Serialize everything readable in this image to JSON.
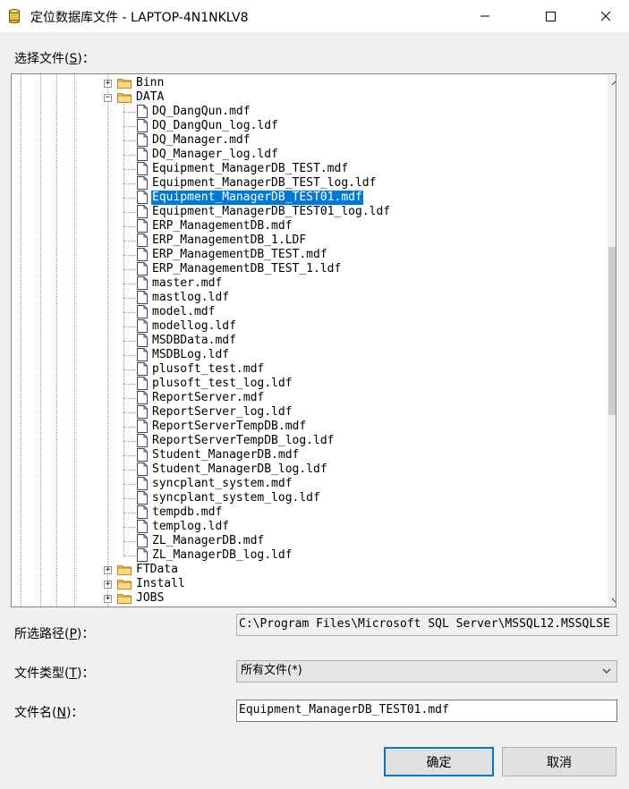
{
  "window": {
    "title": "定位数据库文件 - LAPTOP-4N1NKLV8",
    "icons": {
      "app": "database-icon",
      "minimize": "minimize-icon",
      "maximize": "maximize-icon",
      "close": "close-icon"
    }
  },
  "select_file_label": "选择文件(S)：",
  "tree": {
    "folders_above": [
      {
        "name": "Binn",
        "expanded": false
      }
    ],
    "open_folder": {
      "name": "DATA",
      "expanded": true
    },
    "files": [
      "DQ_DangQun.mdf",
      "DQ_DangQun_log.ldf",
      "DQ_Manager.mdf",
      "DQ_Manager_log.ldf",
      "Equipment_ManagerDB_TEST.mdf",
      "Equipment_ManagerDB_TEST_log.ldf",
      "Equipment_ManagerDB_TEST01.mdf",
      "Equipment_ManagerDB_TEST01_log.ldf",
      "ERP_ManagementDB.mdf",
      "ERP_ManagementDB_1.LDF",
      "ERP_ManagementDB_TEST.mdf",
      "ERP_ManagementDB_TEST_1.ldf",
      "master.mdf",
      "mastlog.ldf",
      "model.mdf",
      "modellog.ldf",
      "MSDBData.mdf",
      "MSDBLog.ldf",
      "plusoft_test.mdf",
      "plusoft_test_log.ldf",
      "ReportServer.mdf",
      "ReportServer_log.ldf",
      "ReportServerTempDB.mdf",
      "ReportServerTempDB_log.ldf",
      "Student_ManagerDB.mdf",
      "Student_ManagerDB_log.ldf",
      "syncplant_system.mdf",
      "syncplant_system_log.ldf",
      "tempdb.mdf",
      "templog.ldf",
      "ZL_ManagerDB.mdf",
      "ZL_ManagerDB_log.ldf"
    ],
    "selected_file": "Equipment_ManagerDB_TEST01.mdf",
    "folders_below": [
      {
        "name": "FTData",
        "expanded": false
      },
      {
        "name": "Install",
        "expanded": false
      },
      {
        "name": "JOBS",
        "expanded": false
      }
    ],
    "scroll_position": 0.33
  },
  "path": {
    "label": "所选路径(P)：",
    "value": "C:\\Program Files\\Microsoft SQL Server\\MSSQL12.MSSQLSE"
  },
  "file_type": {
    "label": "文件类型(T)：",
    "value": "所有文件(*)"
  },
  "file_name": {
    "label": "文件名(N)：",
    "value": "Equipment_ManagerDB_TEST01.mdf"
  },
  "buttons": {
    "ok": "确定",
    "cancel": "取消"
  },
  "colors": {
    "selection": "#0078d7",
    "background": "#f0f0f0",
    "default_button_border": "#0078d7"
  }
}
